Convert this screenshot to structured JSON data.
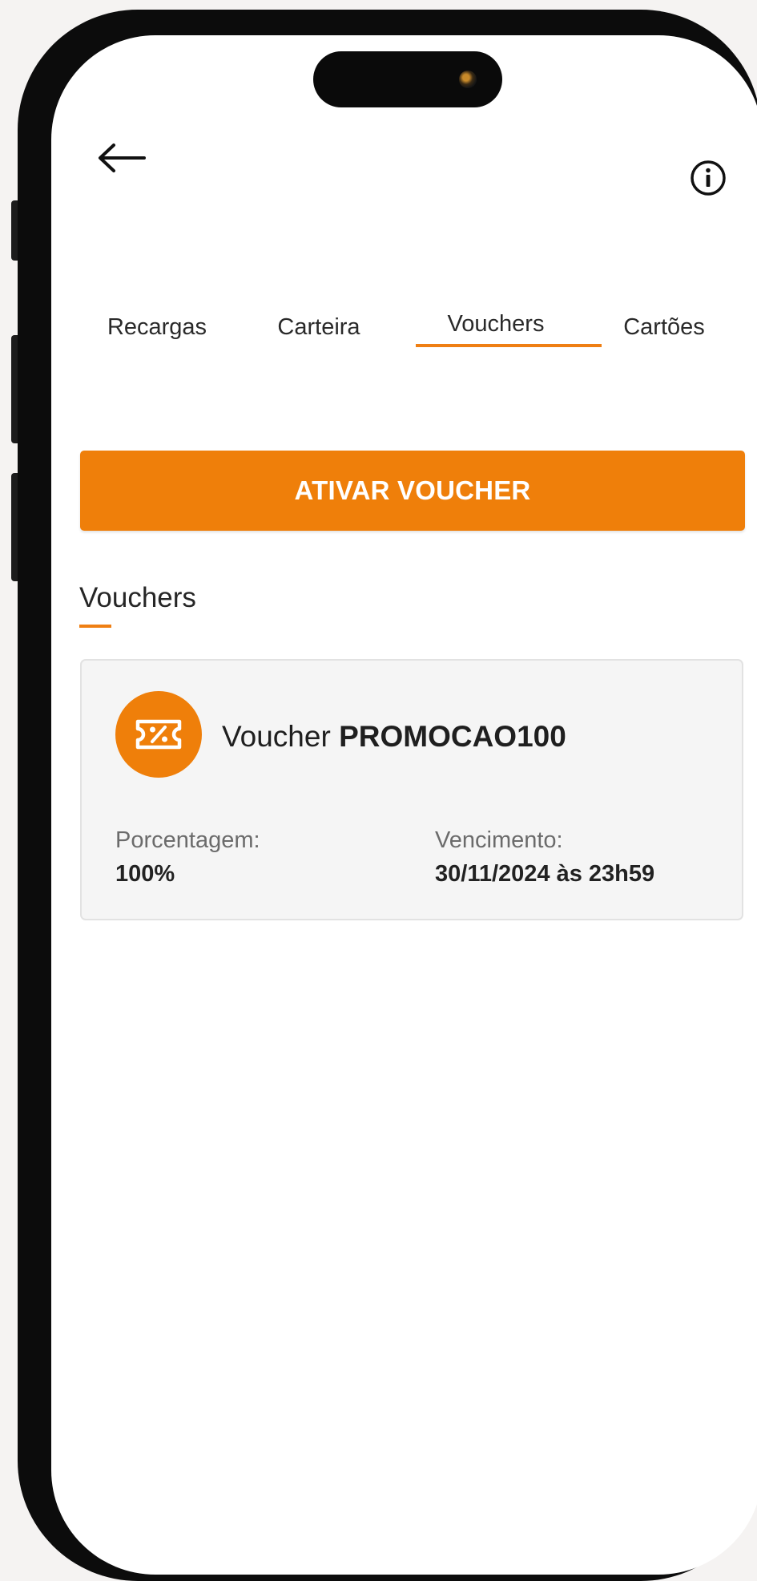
{
  "header": {
    "back_icon": "arrow-left-icon",
    "info_icon": "info-circle-icon"
  },
  "tabs": [
    {
      "label": "Recargas",
      "active": false
    },
    {
      "label": "Carteira",
      "active": false
    },
    {
      "label": "Vouchers",
      "active": true
    },
    {
      "label": "Cartões",
      "active": false
    }
  ],
  "activate_button": {
    "label": "ATIVAR VOUCHER"
  },
  "section": {
    "title": "Vouchers"
  },
  "voucher": {
    "prefix": "Voucher",
    "code": "PROMOCAO100",
    "icon": "ticket-percent-icon",
    "percentage_label": "Porcentagem:",
    "percentage_value": "100%",
    "expiry_label": "Vencimento:",
    "expiry_value": "30/11/2024 às 23h59"
  },
  "colors": {
    "accent": "#EF7F0A",
    "card_background": "#F5F5F5",
    "frame": "#0C0C0C"
  }
}
